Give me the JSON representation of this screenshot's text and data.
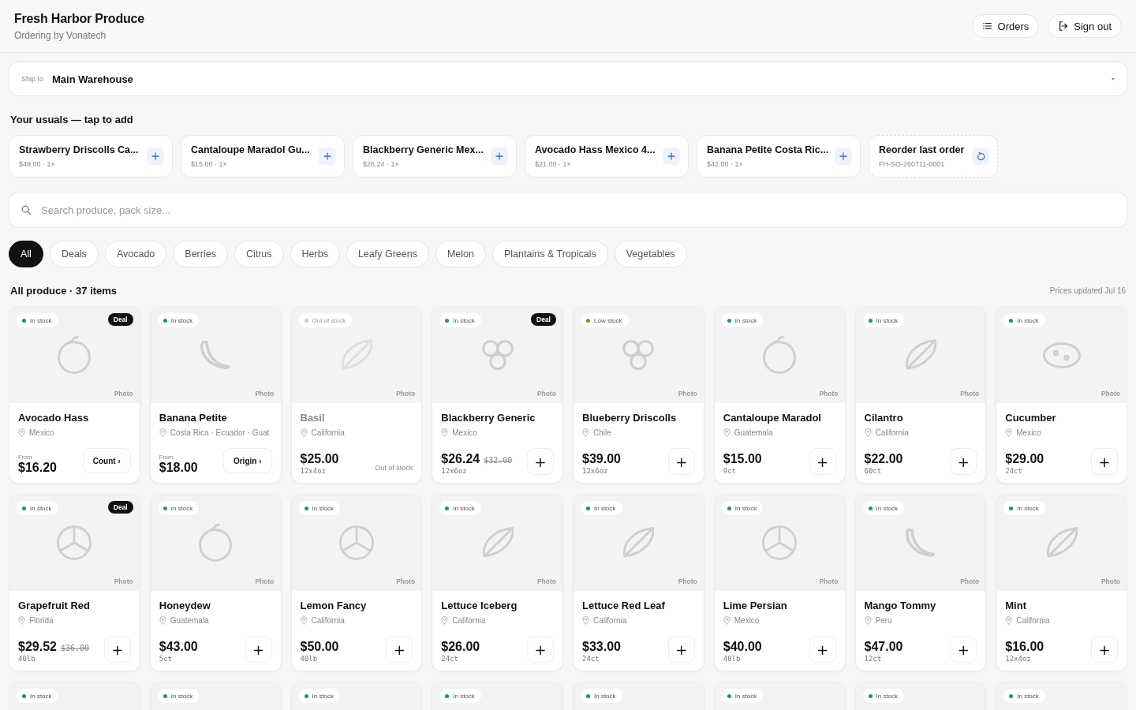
{
  "header": {
    "title": "Fresh Harbor Produce",
    "subtitle": "Ordering by Vonatech",
    "actions": [
      {
        "label": "Orders",
        "kind": "list"
      },
      {
        "label": "Sign out",
        "kind": "exit"
      }
    ]
  },
  "ship_to": {
    "label": "Ship to",
    "value": "Main Warehouse"
  },
  "usuals": {
    "title": "Your usuals — tap to add",
    "items": [
      {
        "kind": "add",
        "name": "Strawberry Driscolls Ca...",
        "detail": "$49.00 · 1×"
      },
      {
        "kind": "add",
        "name": "Cantaloupe Maradol Gu...",
        "detail": "$15.00 · 1×"
      },
      {
        "kind": "add",
        "name": "Blackberry Generic Mex...",
        "detail": "$26.24 · 1×"
      },
      {
        "kind": "add",
        "name": "Avocado Hass Mexico 4...",
        "detail": "$21.00 · 1×"
      },
      {
        "kind": "add",
        "name": "Banana Petite Costa Ric...",
        "detail": "$42.00 · 1×"
      },
      {
        "kind": "reorder",
        "name": "Reorder last order",
        "detail": "FH-SO-260711-0001"
      }
    ]
  },
  "search": {
    "placeholder": "Search produce, pack size..."
  },
  "filters": [
    {
      "label": "All",
      "selected": true
    },
    {
      "label": "Deals",
      "selected": false
    },
    {
      "label": "Avocado",
      "selected": false
    },
    {
      "label": "Berries",
      "selected": false
    },
    {
      "label": "Citrus",
      "selected": false
    },
    {
      "label": "Herbs",
      "selected": false
    },
    {
      "label": "Leafy Greens",
      "selected": false
    },
    {
      "label": "Melon",
      "selected": false
    },
    {
      "label": "Plantains & Tropicals",
      "selected": false
    },
    {
      "label": "Vegetables",
      "selected": false
    }
  ],
  "section": {
    "title": "All produce · 37 items",
    "note": "Prices updated Jul 16"
  },
  "products": [
    {
      "kind": "option",
      "image": {
        "kind": "round",
        "label": "Photo"
      },
      "stock": {
        "label": "In stock",
        "color": "#1e9a5a"
      },
      "deal": "Deal",
      "name": "Avocado Hass",
      "origin": "Mexico",
      "from": "From",
      "price": "$16.20",
      "option": "Count ›"
    },
    {
      "kind": "option",
      "image": {
        "kind": "banana",
        "label": "Photo"
      },
      "stock": {
        "label": "In stock",
        "color": "#1e9a5a"
      },
      "name": "Banana Petite",
      "origin": "Costa Rica · Ecuador · Guat",
      "from": "From",
      "price": "$18.00",
      "option": "Origin ›"
    },
    {
      "kind": "out",
      "image": {
        "kind": "leaf",
        "label": "Photo"
      },
      "stock": {
        "label": "Out of stock",
        "color": "#cccccc"
      },
      "name": "Basil",
      "origin": "California",
      "price": "$25.00",
      "pack": "12x4oz",
      "note": "Out of stock"
    },
    {
      "kind": "add",
      "image": {
        "kind": "berries",
        "label": "Photo"
      },
      "stock": {
        "label": "In stock",
        "color": "#1e9a5a"
      },
      "deal": "Deal",
      "name": "Blackberry Generic",
      "origin": "Mexico",
      "price": "$26.24",
      "old_price": "$32.00",
      "pack": "12x6oz",
      "button": "+"
    },
    {
      "kind": "add",
      "image": {
        "kind": "berries",
        "label": "Photo"
      },
      "stock": {
        "label": "Low stock",
        "color": "#b47d1a"
      },
      "name": "Blueberry Driscolls",
      "origin": "Chile",
      "price": "$39.00",
      "pack": "12x6oz",
      "button": "+"
    },
    {
      "kind": "add",
      "image": {
        "kind": "round",
        "label": "Photo"
      },
      "stock": {
        "label": "In stock",
        "color": "#1e9a5a"
      },
      "name": "Cantaloupe Maradol",
      "origin": "Guatemala",
      "price": "$15.00",
      "pack": "9ct",
      "button": "+"
    },
    {
      "kind": "add",
      "image": {
        "kind": "leaf",
        "label": "Photo"
      },
      "stock": {
        "label": "In stock",
        "color": "#1e9a5a"
      },
      "name": "Cilantro",
      "origin": "California",
      "price": "$22.00",
      "pack": "60ct",
      "button": "+"
    },
    {
      "kind": "add",
      "image": {
        "kind": "cucumber",
        "label": "Photo"
      },
      "stock": {
        "label": "In stock",
        "color": "#1e9a5a"
      },
      "name": "Cucumber",
      "origin": "Mexico",
      "price": "$29.00",
      "pack": "24ct",
      "button": "+"
    },
    {
      "kind": "add",
      "image": {
        "kind": "citrus",
        "label": "Photo"
      },
      "stock": {
        "label": "In stock",
        "color": "#1e9a5a"
      },
      "deal": "Deal",
      "name": "Grapefruit Red",
      "origin": "Florida",
      "price": "$29.52",
      "old_price": "$36.00",
      "pack": "40lb",
      "button": "+"
    },
    {
      "kind": "add",
      "image": {
        "kind": "round",
        "label": "Photo"
      },
      "stock": {
        "label": "In stock",
        "color": "#1e9a5a"
      },
      "name": "Honeydew",
      "origin": "Guatemala",
      "price": "$43.00",
      "pack": "5ct",
      "button": "+"
    },
    {
      "kind": "add",
      "image": {
        "kind": "citrus",
        "label": "Photo"
      },
      "stock": {
        "label": "In stock",
        "color": "#1e9a5a"
      },
      "name": "Lemon Fancy",
      "origin": "California",
      "price": "$50.00",
      "pack": "40lb",
      "button": "+"
    },
    {
      "kind": "add",
      "image": {
        "kind": "leaf",
        "label": "Photo"
      },
      "stock": {
        "label": "In stock",
        "color": "#1e9a5a"
      },
      "name": "Lettuce Iceberg",
      "origin": "California",
      "price": "$26.00",
      "pack": "24ct",
      "button": "+"
    },
    {
      "kind": "add",
      "image": {
        "kind": "leaf",
        "label": "Photo"
      },
      "stock": {
        "label": "In stock",
        "color": "#1e9a5a"
      },
      "name": "Lettuce Red Leaf",
      "origin": "California",
      "price": "$33.00",
      "pack": "24ct",
      "button": "+"
    },
    {
      "kind": "add",
      "image": {
        "kind": "citrus",
        "label": "Photo"
      },
      "stock": {
        "label": "In stock",
        "color": "#1e9a5a"
      },
      "name": "Lime Persian",
      "origin": "Mexico",
      "price": "$40.00",
      "pack": "40lb",
      "button": "+"
    },
    {
      "kind": "add",
      "image": {
        "kind": "banana",
        "label": "Photo"
      },
      "stock": {
        "label": "In stock",
        "color": "#1e9a5a"
      },
      "name": "Mango Tommy",
      "origin": "Peru",
      "price": "$47.00",
      "pack": "12ct",
      "button": "+"
    },
    {
      "kind": "add",
      "image": {
        "kind": "leaf",
        "label": "Photo"
      },
      "stock": {
        "label": "In stock",
        "color": "#1e9a5a"
      },
      "name": "Mint",
      "origin": "California",
      "price": "$16.00",
      "pack": "12x4oz",
      "button": "+"
    },
    {
      "kind": "partial",
      "stock": {
        "label": "In stock",
        "color": "#1e9a5a"
      }
    },
    {
      "kind": "partial",
      "stock": {
        "label": "In stock",
        "color": "#1e9a5a"
      }
    },
    {
      "kind": "partial",
      "stock": {
        "label": "In stock",
        "color": "#1e9a5a"
      }
    },
    {
      "kind": "partial",
      "stock": {
        "label": "In stock",
        "color": "#1e9a5a"
      }
    },
    {
      "kind": "partial",
      "stock": {
        "label": "In stock",
        "color": "#1e9a5a"
      }
    },
    {
      "kind": "partial",
      "stock": {
        "label": "In stock",
        "color": "#1e9a5a"
      }
    },
    {
      "kind": "partial",
      "stock": {
        "label": "In stock",
        "color": "#1e9a5a"
      }
    },
    {
      "kind": "partial",
      "stock": {
        "label": "In stock",
        "color": "#1e9a5a"
      }
    }
  ]
}
